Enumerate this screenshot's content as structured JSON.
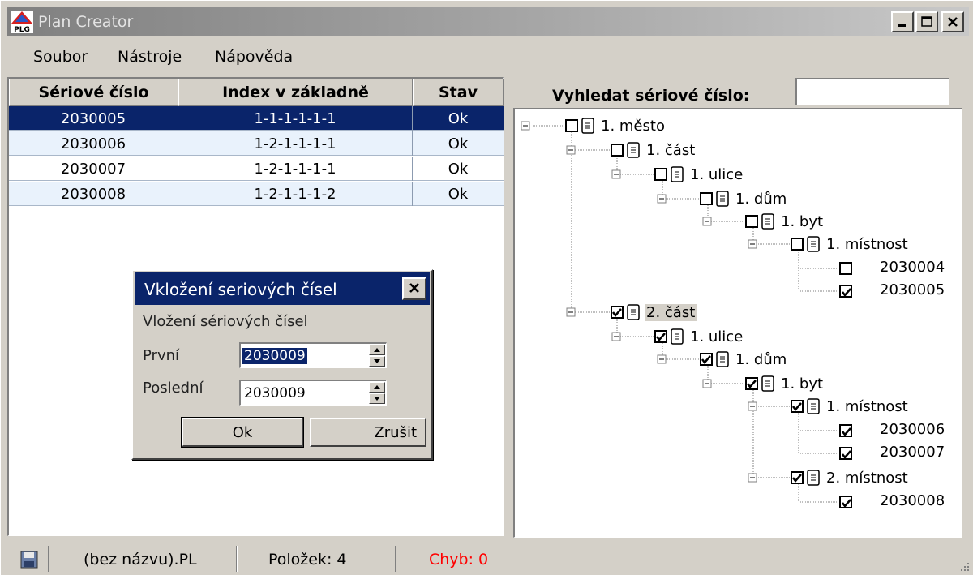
{
  "window": {
    "title": "Plan Creator",
    "icon_text": "PLG"
  },
  "menu": [
    "Soubor",
    "Nástroje",
    "Nápověda"
  ],
  "list": {
    "columns": [
      "Sériové číslo",
      "Index v základně",
      "Stav"
    ],
    "rows": [
      {
        "serial": "2030005",
        "index": "1-1-1-1-1-1",
        "status": "Ok",
        "selected": true
      },
      {
        "serial": "2030006",
        "index": "1-2-1-1-1-1",
        "status": "Ok",
        "selected": false
      },
      {
        "serial": "2030007",
        "index": "1-2-1-1-1-1",
        "status": "Ok",
        "selected": false
      },
      {
        "serial": "2030008",
        "index": "1-2-1-1-1-2",
        "status": "Ok",
        "selected": false
      }
    ]
  },
  "search": {
    "label": "Vyhledat sériové číslo:",
    "value": ""
  },
  "tree": {
    "nodes": [
      {
        "label": "1. město",
        "checked": false
      },
      {
        "label": "1. část",
        "checked": false
      },
      {
        "label": "1. ulice",
        "checked": false
      },
      {
        "label": "1. dům",
        "checked": false
      },
      {
        "label": "1. byt",
        "checked": false
      },
      {
        "label": "1. místnost",
        "checked": false
      },
      {
        "label": "2030004",
        "checked": false
      },
      {
        "label": "2030005",
        "checked": true
      },
      {
        "label": "2. část",
        "checked": true,
        "highlighted": true
      },
      {
        "label": "1. ulice",
        "checked": true
      },
      {
        "label": "1. dům",
        "checked": true
      },
      {
        "label": "1. byt",
        "checked": true
      },
      {
        "label": "1. místnost",
        "checked": true
      },
      {
        "label": "2030006",
        "checked": true
      },
      {
        "label": "2030007",
        "checked": true
      },
      {
        "label": "2. místnost",
        "checked": true
      },
      {
        "label": "2030008",
        "checked": true
      }
    ]
  },
  "dialog": {
    "title": "Vkložení seriových čísel",
    "heading": "Vložení sériových čísel",
    "first_label": "První",
    "first_value": "2030009",
    "last_label": "Poslední",
    "last_value": "2030009",
    "ok_label": "Ok",
    "cancel_label": "Zrušit"
  },
  "status": {
    "filename": "(bez názvu).PL",
    "items": "Položek: 4",
    "errors": "Chyb: 0",
    "error_color": "#ff0000"
  },
  "colors": {
    "selection": "#0a246a",
    "row_alt": "#e9f2fc",
    "face": "#d4d0c8"
  }
}
